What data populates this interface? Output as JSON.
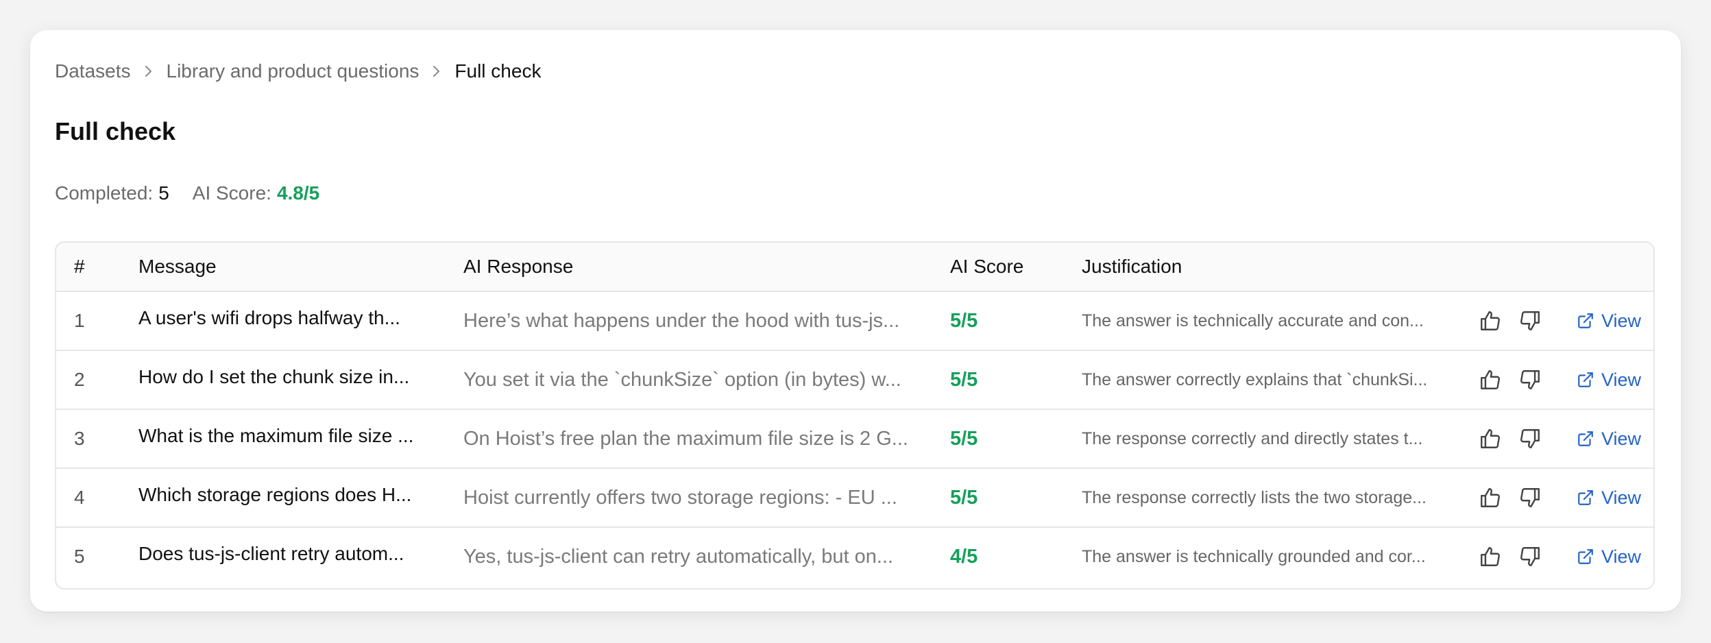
{
  "breadcrumb": {
    "items": [
      "Datasets",
      "Library and product questions",
      "Full check"
    ]
  },
  "page": {
    "title": "Full check"
  },
  "stats": {
    "completed_label": "Completed:",
    "completed_value": "5",
    "score_label": "AI Score:",
    "score_value": "4.8/5"
  },
  "table": {
    "headers": [
      "#",
      "Message",
      "AI Response",
      "AI Score",
      "Justification"
    ],
    "view_label": "View",
    "rows": [
      {
        "num": "1",
        "message": "A user's wifi drops halfway th...",
        "response": "Here’s what happens under the hood with tus-js...",
        "score": "5/5",
        "justification": "The answer is technically accurate and con..."
      },
      {
        "num": "2",
        "message": "How do I set the chunk size in...",
        "response": "You set it via the `chunkSize` option (in bytes) w...",
        "score": "5/5",
        "justification": "The answer correctly explains that `chunkSi..."
      },
      {
        "num": "3",
        "message": "What is the maximum file size ...",
        "response": "On Hoist’s free plan the maximum file size is 2 G...",
        "score": "5/5",
        "justification": "The response correctly and directly states t..."
      },
      {
        "num": "4",
        "message": "Which storage regions does H...",
        "response": "Hoist currently offers two storage regions: - EU ...",
        "score": "5/5",
        "justification": "The response correctly lists the two storage..."
      },
      {
        "num": "5",
        "message": "Does tus-js-client retry autom...",
        "response": "Yes, tus-js-client can retry automatically, but on...",
        "score": "4/5",
        "justification": "The answer is technically grounded and cor..."
      }
    ]
  },
  "colors": {
    "score_green": "#16a05a",
    "link_blue": "#2563c9",
    "muted_text": "#6b6b6b"
  },
  "icons": [
    "chevron-right-icon",
    "thumbs-up-icon",
    "thumbs-down-icon",
    "external-link-icon"
  ]
}
